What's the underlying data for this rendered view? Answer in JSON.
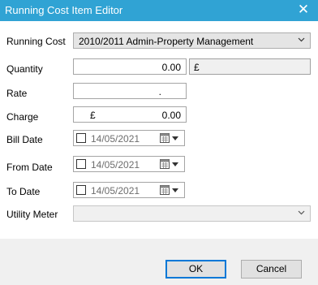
{
  "window": {
    "title": "Running Cost Item Editor",
    "close_glyph": "✕"
  },
  "form": {
    "running_cost": {
      "label": "Running Cost",
      "value": "2010/2011 Admin-Property Management"
    },
    "quantity": {
      "label": "Quantity",
      "value": "0.00",
      "unit": "£"
    },
    "rate": {
      "label": "Rate",
      "value": "."
    },
    "charge": {
      "label": "Charge",
      "currency": "£",
      "value": "0.00"
    },
    "bill_date": {
      "label": "Bill Date",
      "value": "14/05/2021",
      "checked": false
    },
    "from_date": {
      "label": "From Date",
      "value": "14/05/2021",
      "checked": false
    },
    "to_date": {
      "label": "To Date",
      "value": "14/05/2021",
      "checked": false
    },
    "utility_meter": {
      "label": "Utility Meter",
      "value": ""
    }
  },
  "buttons": {
    "ok": "OK",
    "cancel": "Cancel"
  },
  "colors": {
    "titlebar": "#30a3d4",
    "body": "#ffffff",
    "footer": "#f0f0f0",
    "default_button_border": "#0078d7"
  },
  "icons": {
    "close": "close-icon",
    "dropdown": "chevron-down-icon",
    "calendar": "calendar-icon"
  }
}
